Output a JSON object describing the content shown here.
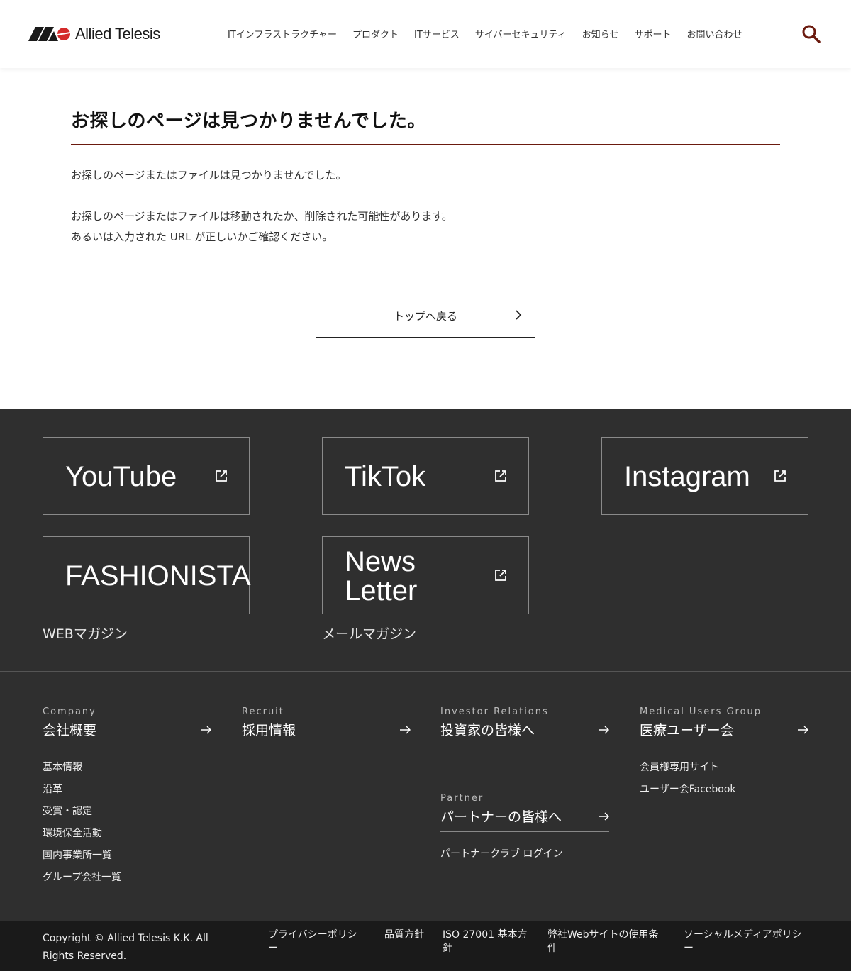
{
  "header": {
    "logo_text": "Allied Telesis",
    "nav": [
      "ITインフラストラクチャー",
      "プロダクト",
      "ITサービス",
      "サイバーセキュリティ",
      "お知らせ",
      "サポート",
      "お問い合わせ"
    ]
  },
  "main": {
    "title": "お探しのページは見つかりませんでした。",
    "msg1": "お探しのページまたはファイルは見つかりませんでした。",
    "msg2_line1": "お探しのページまたはファイルは移動されたか、削除された可能性があります。",
    "msg2_line2": "あるいは入力された URL が正しいかご確認ください。",
    "back_button": "トップへ戻る"
  },
  "social": {
    "youtube": "YouTube",
    "tiktok": "TikTok",
    "instagram": "Instagram",
    "fashionista": "FASHIONISTA",
    "fashionista_sub": "WEBマガジン",
    "newsletter_line1": "News",
    "newsletter_line2": "Letter",
    "newsletter_sub": "メールマガジン"
  },
  "footer_cols": {
    "company": {
      "en": "Company",
      "jp": "会社概要",
      "items": [
        "基本情報",
        "沿革",
        "受賞・認定",
        "環境保全活動",
        "国内事業所一覧",
        "グループ会社一覧"
      ]
    },
    "recruit": {
      "en": "Recruit",
      "jp": "採用情報"
    },
    "ir": {
      "en": "Investor Relations",
      "jp": "投資家の皆様へ"
    },
    "partner": {
      "en": "Partner",
      "jp": "パートナーの皆様へ",
      "items": [
        "パートナークラブ ログイン"
      ]
    },
    "medical": {
      "en": "Medical Users Group",
      "jp": "医療ユーザー会",
      "items": [
        "会員様専用サイト",
        "ユーザー会Facebook"
      ]
    }
  },
  "bottom": {
    "copyright": "Copyright © Allied Telesis K.K. All Rights Reserved.",
    "links": [
      "プライバシーポリシー",
      "品質方針",
      "ISO 27001 基本方針",
      "弊社Webサイトの使用条件",
      "ソーシャルメディアポリシー"
    ]
  },
  "colors": {
    "accent": "#6b1a0e",
    "footer_bg": "#2f2f2f",
    "bottom_bg": "#1a1a1a"
  }
}
